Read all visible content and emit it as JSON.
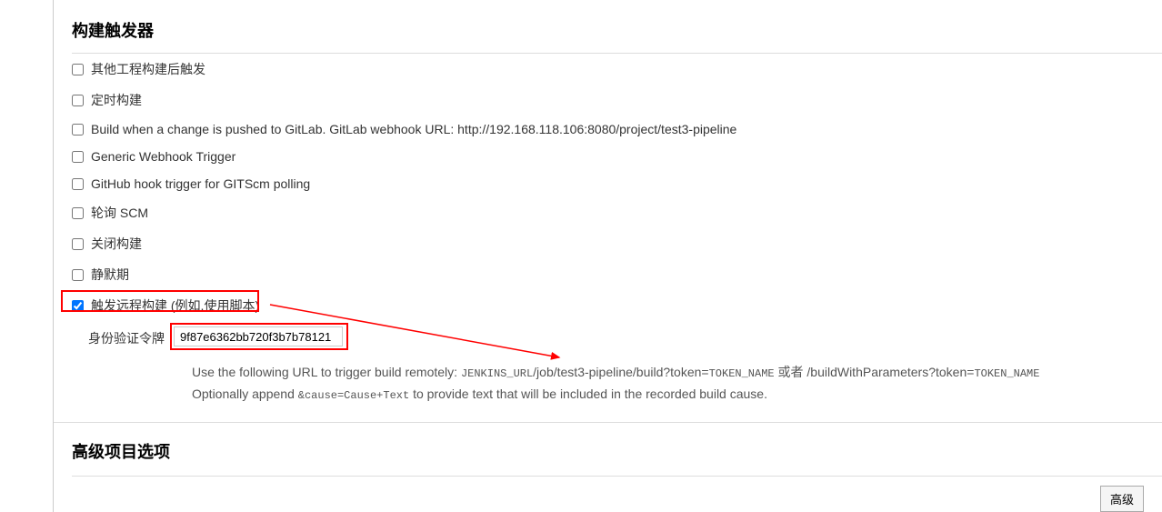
{
  "section": {
    "title": "构建触发器"
  },
  "triggers": {
    "buildAfter": "其他工程构建后触发",
    "cron": "定时构建",
    "gitlab": "Build when a change is pushed to GitLab. GitLab webhook URL: http://192.168.118.106:8080/project/test3-pipeline",
    "genericWebhook": "Generic Webhook Trigger",
    "github": "GitHub hook trigger for GITScm polling",
    "pollScm": "轮询 SCM",
    "disableBuild": "关闭构建",
    "quietPeriod": "静默期",
    "remoteTrigger": "触发远程构建 (例如,使用脚本)"
  },
  "remote": {
    "tokenLabel": "身份验证令牌",
    "tokenValue": "9f87e6362bb720f3b7b78121",
    "helpLine1Prefix": "Use the following URL to trigger build remotely: ",
    "helpUrlPart1": "JENKINS_URL",
    "helpUrlPart2": "/job/test3-pipeline/build?token=",
    "helpTokenName": "TOKEN_NAME",
    "helpOr": " 或者 /buildWithParameters?token=",
    "helpLine2Prefix": "Optionally append ",
    "helpCause": "&cause=Cause+Text",
    "helpLine2Suffix": " to provide text that will be included in the recorded build cause."
  },
  "advanced": {
    "title": "高级项目选项",
    "buttonLabel": "高级"
  }
}
